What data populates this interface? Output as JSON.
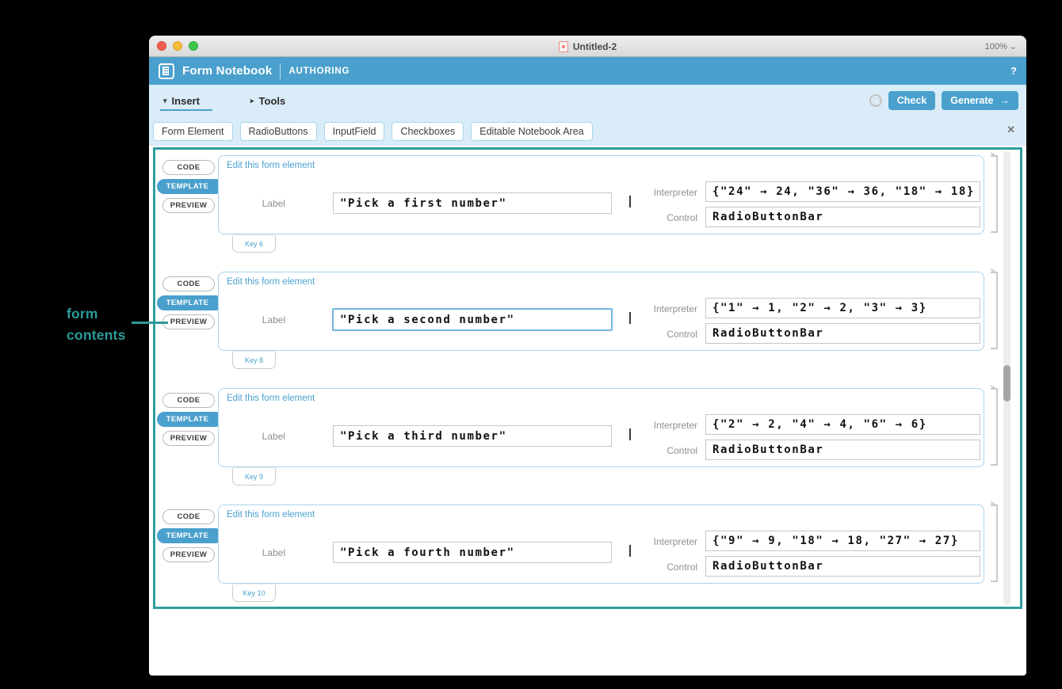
{
  "window": {
    "title": "Untitled-2",
    "zoom_label": "100%",
    "zoom_chevron": "⌄"
  },
  "header": {
    "app_title": "Form Notebook",
    "mode": "AUTHORING",
    "help_label": "?"
  },
  "menus": {
    "insert": {
      "arrow": "▾",
      "label": "Insert"
    },
    "tools": {
      "arrow": "▸",
      "label": "Tools"
    }
  },
  "actions": {
    "check_label": "Check",
    "generate_label": "Generate",
    "generate_arrow": "→"
  },
  "palette": {
    "buttons": [
      "Form Element",
      "RadioButtons",
      "InputField",
      "Checkboxes",
      "Editable Notebook Area"
    ],
    "close_label": "✕"
  },
  "card_tabs": {
    "code": "CODE",
    "template": "TEMPLATE",
    "preview": "PREVIEW"
  },
  "field_names": {
    "label": "Label",
    "interpreter": "Interpreter",
    "control": "Control"
  },
  "form_elements": [
    {
      "edit_hint": "Edit this form element",
      "label_value": "\"Pick a first number\"",
      "interpreter_value": "{\"24\" → 24, \"36\" → 36, \"18\" → 18}",
      "control_value": "RadioButtonBar",
      "key": "Key 6",
      "focused": false
    },
    {
      "edit_hint": "Edit this form element",
      "label_value": "\"Pick a second number\"",
      "interpreter_value": "{\"1\" → 1, \"2\" → 2, \"3\" → 3}",
      "control_value": "RadioButtonBar",
      "key": "Key 8",
      "focused": true
    },
    {
      "edit_hint": "Edit this form element",
      "label_value": "\"Pick a third number\"",
      "interpreter_value": "{\"2\" → 2, \"4\" → 4, \"6\" → 6}",
      "control_value": "RadioButtonBar",
      "key": "Key 9",
      "focused": false
    },
    {
      "edit_hint": "Edit this form element",
      "label_value": "\"Pick a fourth number\"",
      "interpreter_value": "{\"9\" → 9, \"18\" → 18, \"27\" → 27}",
      "control_value": "RadioButtonBar",
      "key": "Key 10",
      "focused": false
    }
  ],
  "annotation": {
    "line1": "form",
    "line2": "contents"
  },
  "colors": {
    "accent_blue": "#4aa0cd",
    "toolbar_bg": "#d9ecf8",
    "teal": "#2d9a9a",
    "card_border": "#a9d5ee"
  }
}
